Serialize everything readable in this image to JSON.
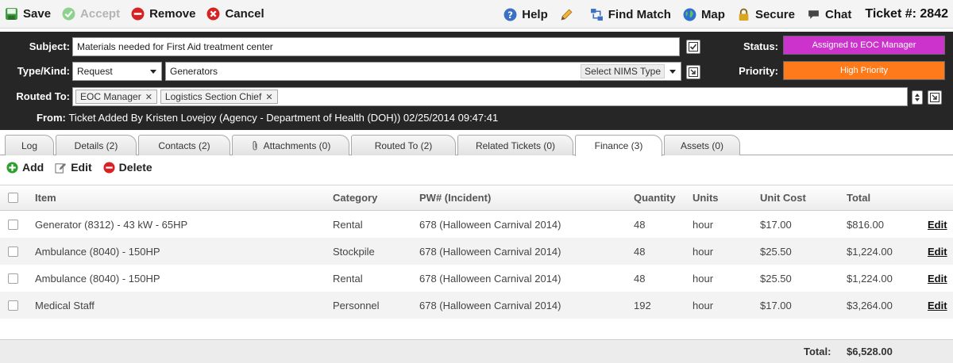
{
  "toolbar": {
    "save": "Save",
    "accept": "Accept",
    "remove": "Remove",
    "cancel": "Cancel",
    "help": "Help",
    "find_match": "Find Match",
    "map": "Map",
    "secure": "Secure",
    "chat": "Chat",
    "ticket_label": "Ticket #: 2842"
  },
  "header": {
    "subject_label": "Subject:",
    "subject_value": "Materials needed for First Aid treatment center",
    "type_label": "Type/Kind:",
    "type_value": "Request",
    "kind_value": "Generators",
    "nims_label": "Select NIMS Type",
    "routed_label": "Routed To:",
    "routed_tags": [
      "EOC Manager",
      "Logistics Section Chief"
    ],
    "status_label": "Status:",
    "status_value": "Assigned to EOC Manager",
    "status_color": "#cc33cc",
    "priority_label": "Priority:",
    "priority_value": "High Priority",
    "priority_color": "#ff7a1a",
    "from_label": "From:",
    "from_value": "Ticket Added By Kristen Lovejoy (Agency - Department of Health (DOH)) 02/25/2014 09:47:41"
  },
  "tabs": [
    {
      "label": "Log"
    },
    {
      "label": "Details (2)"
    },
    {
      "label": "Contacts (2)"
    },
    {
      "label": "Attachments (0)"
    },
    {
      "label": "Routed To (2)"
    },
    {
      "label": "Related Tickets (0)"
    },
    {
      "label": "Finance (3)"
    },
    {
      "label": "Assets (0)"
    }
  ],
  "finance": {
    "add": "Add",
    "edit": "Edit",
    "delete": "Delete",
    "columns": {
      "item": "Item",
      "category": "Category",
      "pw": "PW# (Incident)",
      "quantity": "Quantity",
      "units": "Units",
      "unit_cost": "Unit Cost",
      "total": "Total"
    },
    "rows": [
      {
        "item": "Generator (8312) - 43 kW - 65HP",
        "category": "Rental",
        "pw": "678 (Halloween Carnival 2014)",
        "quantity": "48",
        "units": "hour",
        "unit_cost": "$17.00",
        "total": "$816.00",
        "edit": "Edit"
      },
      {
        "item": "Ambulance (8040) - 150HP",
        "category": "Stockpile",
        "pw": "678 (Halloween Carnival 2014)",
        "quantity": "48",
        "units": "hour",
        "unit_cost": "$25.50",
        "total": "$1,224.00",
        "edit": "Edit"
      },
      {
        "item": "Ambulance (8040) - 150HP",
        "category": "Rental",
        "pw": "678 (Halloween Carnival 2014)",
        "quantity": "48",
        "units": "hour",
        "unit_cost": "$25.50",
        "total": "$1,224.00",
        "edit": "Edit"
      },
      {
        "item": "Medical Staff",
        "category": "Personnel",
        "pw": "678 (Halloween Carnival 2014)",
        "quantity": "192",
        "units": "hour",
        "unit_cost": "$17.00",
        "total": "$3,264.00",
        "edit": "Edit"
      }
    ],
    "total_label": "Total:",
    "total_value": "$6,528.00"
  }
}
